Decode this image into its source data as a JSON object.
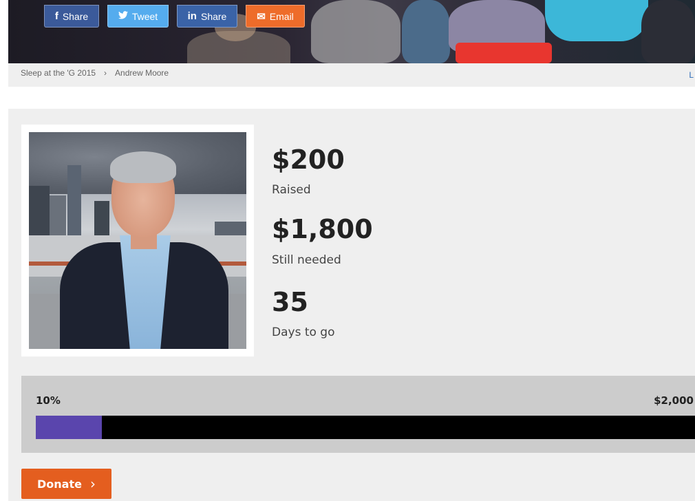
{
  "share": {
    "facebook_label": "Share",
    "twitter_label": "Tweet",
    "linkedin_label": "Share",
    "email_label": "Email",
    "facebook_icon": "f",
    "twitter_icon": "🐦",
    "linkedin_icon": "in",
    "email_icon": "✉"
  },
  "breadcrumb": {
    "items": [
      "Sleep at the 'G 2015",
      "Andrew Moore"
    ],
    "separator": "›",
    "edge_text": "L"
  },
  "stats": {
    "raised_amount": "$200",
    "raised_label": "Raised",
    "needed_amount": "$1,800",
    "needed_label": "Still needed",
    "days_amount": "35",
    "days_label": "Days to go"
  },
  "progress": {
    "percent_label": "10%",
    "goal_label": "$2,000",
    "fraction": 0.1
  },
  "donate": {
    "label": "Donate",
    "chevron": "›"
  },
  "colors": {
    "progress_fill": "#5a45ad",
    "donate_bg": "#e45e1f"
  }
}
